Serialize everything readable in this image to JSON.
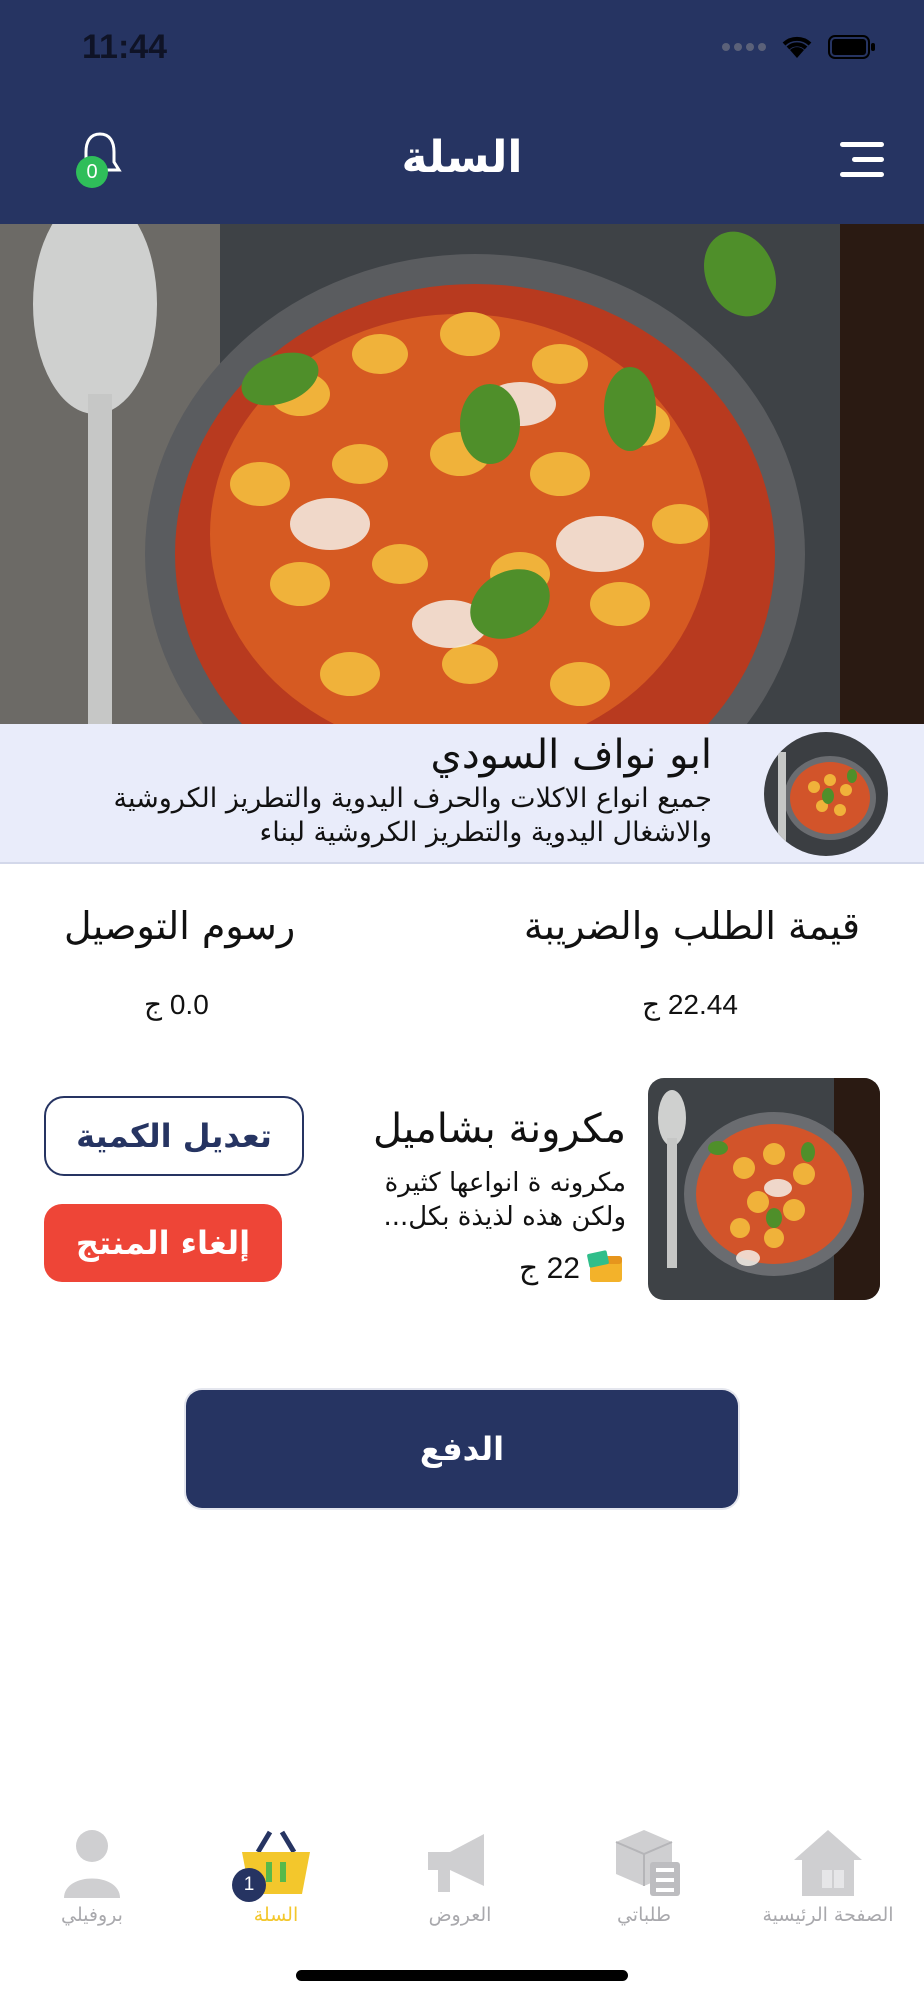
{
  "status_bar": {
    "time": "11:44"
  },
  "header": {
    "title": "السلة",
    "notification_count": "0"
  },
  "restaurant": {
    "name": "ابو نواف السودي",
    "description": "جميع انواع الاكلات والحرف اليدوية والتطريز الكروشية والاشغال اليدوية والتطريز الكروشية لبناء"
  },
  "totals": {
    "order_tax_label": "قيمة الطلب والضريبة",
    "order_tax_value": "22.44 ج",
    "delivery_label": "رسوم التوصيل",
    "delivery_value": "0.0 ج"
  },
  "cart_item": {
    "name": "مكرونة بشاميل",
    "description": "مكرونه ة انواعها كثيرة ولكن هذه لذيذة بكل...",
    "price": "22 ج",
    "edit_label": "تعديل الكمية",
    "cancel_label": "إلغاء المنتج"
  },
  "pay_label": "الدفع",
  "tabs": [
    {
      "label": "بروفيلي",
      "icon": "profile-icon"
    },
    {
      "label": "السلة",
      "icon": "basket-icon",
      "badge": "1"
    },
    {
      "label": "العروض",
      "icon": "megaphone-icon"
    },
    {
      "label": "طلباتي",
      "icon": "orders-box-icon"
    },
    {
      "label": "الصفحة الرئيسية",
      "icon": "home-icon"
    }
  ],
  "colors": {
    "primary": "#263462",
    "accent": "#f3c72c",
    "danger": "#ee4537",
    "badge_green": "#2fbe5a",
    "strip_bg": "#e9ecfa"
  }
}
